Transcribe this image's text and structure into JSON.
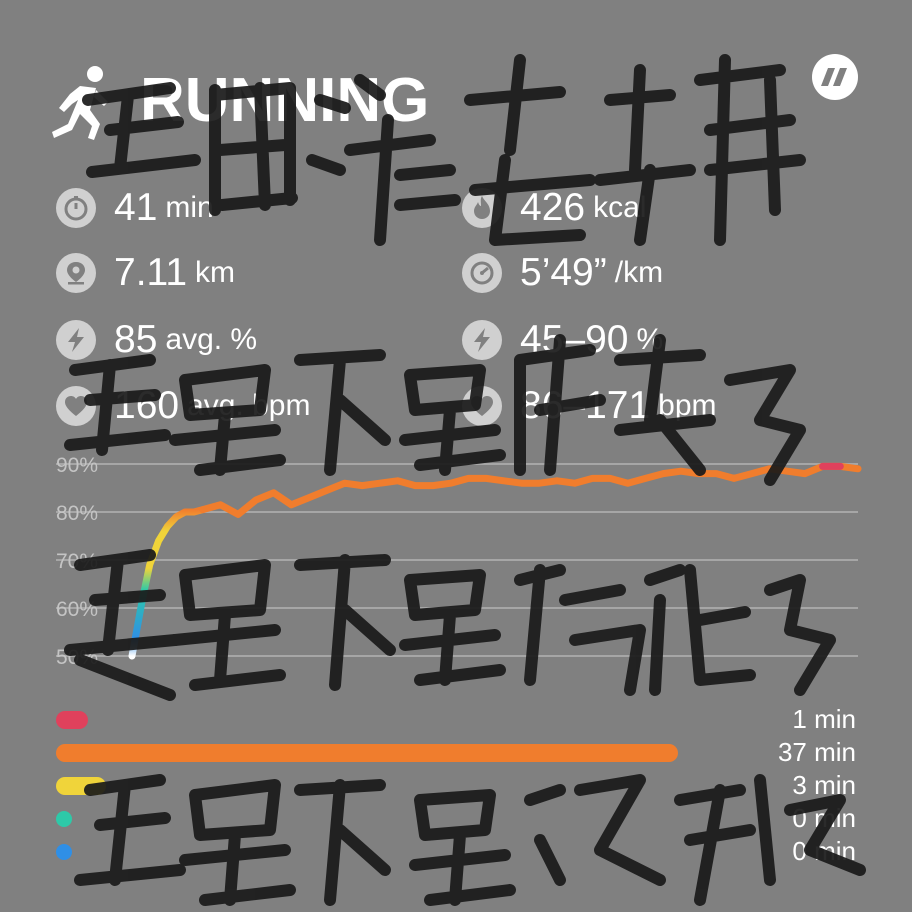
{
  "header": {
    "title": "RUNNING",
    "activity_icon": "running-person-icon",
    "brand_icon": "double-slash-logo-icon"
  },
  "stats": {
    "left": [
      {
        "icon": "stopwatch-icon",
        "value": "41",
        "unit": "min"
      },
      {
        "icon": "location-pin-icon",
        "value": "7.11",
        "unit": "km"
      },
      {
        "icon": "lightning-icon",
        "value": "85",
        "unit": "avg. %"
      },
      {
        "icon": "heart-icon",
        "value": "160",
        "unit": "avg. bpm"
      }
    ],
    "right": [
      {
        "icon": "flame-icon",
        "value": "426",
        "unit": "kcal"
      },
      {
        "icon": "speedometer-icon",
        "value": "5’49”",
        "unit": "/km"
      },
      {
        "icon": "lightning-icon",
        "value": "45–90",
        "unit": "%"
      },
      {
        "icon": "heart-icon",
        "value": "86–171",
        "unit": "bpm"
      }
    ]
  },
  "chart_data": {
    "type": "line",
    "title": "",
    "xlabel": "",
    "ylabel": "",
    "y_ticks": [
      "90%",
      "80%",
      "70%",
      "60%",
      "50%"
    ],
    "ylim": [
      48,
      92
    ],
    "xlim": [
      0,
      41
    ],
    "grid": true,
    "series": [
      {
        "x": [
          0,
          0.3,
          0.6,
          1,
          1.5,
          2,
          2.5,
          3,
          3.5,
          4,
          5,
          6,
          7,
          8,
          9,
          10,
          11,
          12,
          13,
          14,
          15,
          16,
          17,
          18,
          19,
          20,
          21,
          22,
          23,
          24,
          25,
          26,
          27,
          28,
          29,
          30,
          31,
          32,
          33,
          34,
          35,
          36,
          37,
          38,
          39,
          40,
          41
        ],
        "y": [
          50,
          56,
          62,
          69,
          74,
          77,
          79,
          80,
          80,
          80.5,
          81.5,
          79.5,
          82.5,
          84,
          81.5,
          83,
          84.5,
          86,
          85.5,
          86,
          86.5,
          85.5,
          85.5,
          86,
          87,
          87,
          86.5,
          86,
          86,
          86.5,
          86,
          87,
          87,
          86,
          87,
          88,
          88.5,
          88,
          88,
          87,
          88,
          89,
          88.5,
          88,
          89.5,
          89.5,
          89
        ]
      }
    ]
  },
  "zones": [
    {
      "color": "#e0415c",
      "duration": "1 min",
      "fraction": 0.027
    },
    {
      "color": "#f07d2d",
      "duration": "37 min",
      "fraction": 1.0
    },
    {
      "color": "#f0d43a",
      "duration": "3 min",
      "fraction": 0.081
    },
    {
      "color": "#2ec9a8",
      "duration": "0 min",
      "fraction": 0
    },
    {
      "color": "#2f8fe6",
      "duration": "0 min",
      "fraction": 0
    }
  ],
  "colors": {
    "background": "#808080",
    "orange": "#f07d2d",
    "yellow": "#f0d43a",
    "teal": "#2ec9a8",
    "blue": "#2f8fe6",
    "red": "#e0415c"
  }
}
